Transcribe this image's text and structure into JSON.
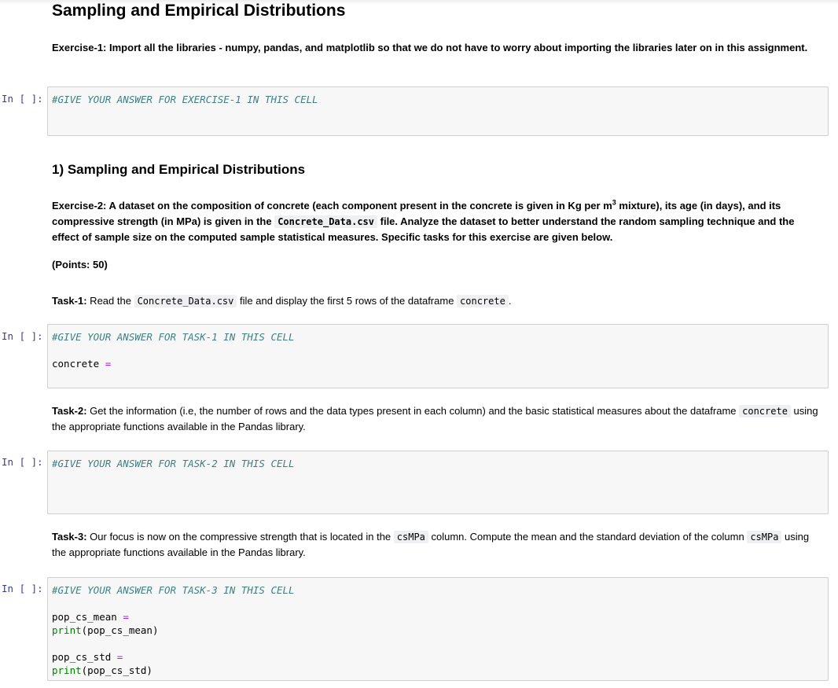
{
  "title": "Sampling and Empirical Distributions",
  "exercise1": {
    "label": "Exercise-1:",
    "text": "Import all the libraries - numpy, pandas, and matplotlib so that we do not have to worry about importing the libraries later on in this assignment."
  },
  "prompt": "In [ ]:",
  "cell1": {
    "comment": "#GIVE YOUR ANSWER FOR EXERCISE-1 IN THIS CELL"
  },
  "section_title": "1) Sampling and Empirical Distributions",
  "exercise2": {
    "label": "Exercise-2:",
    "text_a": "A dataset on the composition of concrete (each component present in the concrete is given in Kg per m",
    "sup": "3",
    "text_b": " mixture), its age (in days), and its compressive strength (in MPa) is given in the ",
    "file": "Concrete_Data.csv",
    "text_c": " file. Analyze the dataset to better understand the random sampling technique and the effect of sample size on the computed sample statistical measures. Specific tasks for this exercise are given below."
  },
  "points": "(Points: 50)",
  "task1": {
    "label": "Task-1:",
    "text_a": " Read the ",
    "file": "Concrete_Data.csv",
    "text_b": " file and display the first 5 rows of the dataframe ",
    "df": "concrete",
    "text_c": "."
  },
  "cell2": {
    "comment": "#GIVE YOUR ANSWER FOR TASK-1 IN THIS CELL",
    "var": "concrete ",
    "eq": "="
  },
  "task2": {
    "label": "Task-2:",
    "text_a": " Get the information (i.e, the number of rows and the data types present in each column) and the basic statistical measures about the dataframe ",
    "df": "concrete",
    "text_b": " using the appropriate functions available in the Pandas library."
  },
  "cell3": {
    "comment": "#GIVE YOUR ANSWER FOR TASK-2 IN THIS CELL"
  },
  "task3": {
    "label": "Task-3:",
    "text_a": " Our focus is now on the compressive strength that is located in the ",
    "col": "csMPa",
    "text_b": " column. Compute the mean and the standard deviation of the column ",
    "col2": "csMPa",
    "text_c": " using the appropriate functions available in the Pandas library."
  },
  "cell4": {
    "comment": "#GIVE YOUR ANSWER FOR TASK-3 IN THIS CELL",
    "mean_var": "pop_cs_mean ",
    "eq": "=",
    "print_fn": "print",
    "print_mean_arg": "(pop_cs_mean)",
    "std_var": "pop_cs_std ",
    "print_std_arg": "(pop_cs_std)"
  }
}
